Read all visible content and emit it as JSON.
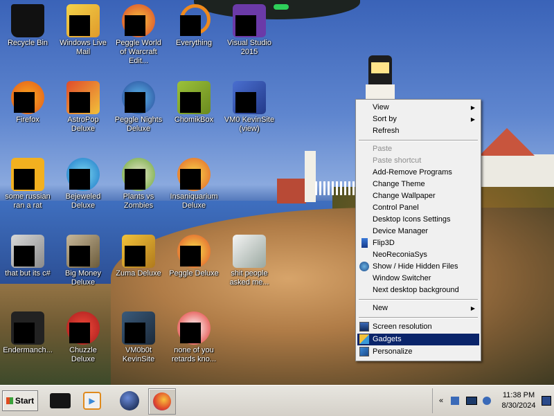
{
  "desktop": {
    "icons": [
      {
        "label": "Recycle Bin"
      },
      {
        "label": "Windows Live Mail"
      },
      {
        "label": "Peggle World of Warcraft Edit..."
      },
      {
        "label": "Everything"
      },
      {
        "label": "Visual Studio 2015"
      },
      {
        "label": "Firefox"
      },
      {
        "label": "AstroPop Deluxe"
      },
      {
        "label": "Peggle Nights Deluxe"
      },
      {
        "label": "ChomikBox"
      },
      {
        "label": "VM0 KevinSite (view)"
      },
      {
        "label": "some russian ran a rat"
      },
      {
        "label": "Bejeweled Deluxe"
      },
      {
        "label": "Plants vs Zombies"
      },
      {
        "label": "Insaniquarium Deluxe"
      },
      {
        "label": "that but its c#"
      },
      {
        "label": "Big Money Deluxe"
      },
      {
        "label": "Zuma Deluxe"
      },
      {
        "label": "Peggle Deluxe"
      },
      {
        "label": "shit people asked me..."
      },
      {
        "label": "Endermanch..."
      },
      {
        "label": "Chuzzle Deluxe"
      },
      {
        "label": "VM0b0t KevinSite"
      },
      {
        "label": "none of you retards kno..."
      }
    ]
  },
  "context_menu": {
    "view": "View",
    "sort_by": "Sort by",
    "refresh": "Refresh",
    "paste": "Paste",
    "paste_shortcut": "Paste shortcut",
    "add_remove": "Add-Remove Programs",
    "change_theme": "Change Theme",
    "change_wallpaper": "Change Wallpaper",
    "control_panel": "Control Panel",
    "desktop_icons": "Desktop Icons Settings",
    "device_manager": "Device Manager",
    "flip3d": "Flip3D",
    "neoreconiasys": "NeoReconiaSys",
    "show_hide": "Show / Hide Hidden Files",
    "window_switcher": "Window Switcher",
    "next_bg": "Next desktop background",
    "new": "New",
    "screen_resolution": "Screen resolution",
    "gadgets": "Gadgets",
    "personalize": "Personalize",
    "highlighted": "Gadgets"
  },
  "taskbar": {
    "start_label": "Start",
    "clock_time": "11:38 PM",
    "clock_date": "8/30/2024",
    "tray_chevron": "«"
  },
  "colors": {
    "menu_highlight": "#0a246a",
    "taskbar": "#d4d0c8"
  }
}
